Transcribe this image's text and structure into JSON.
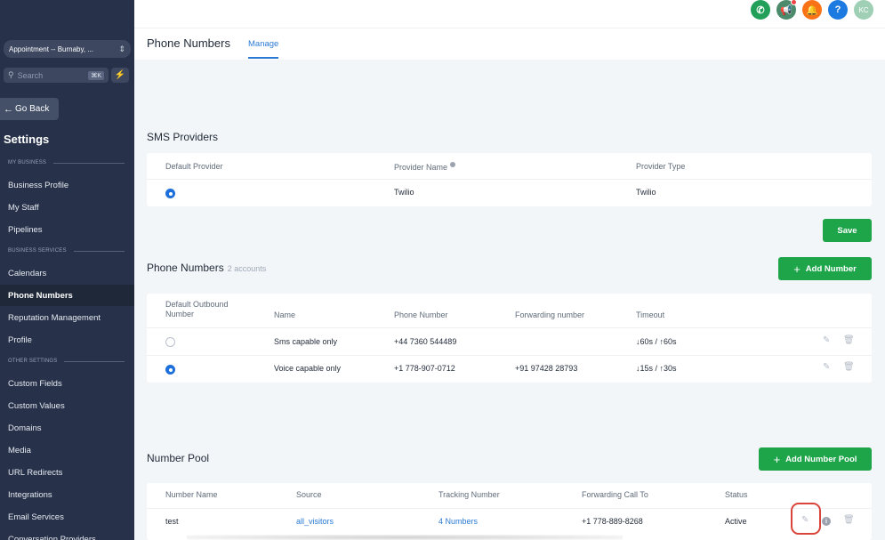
{
  "sidebar": {
    "location": "Appointment -- Burnaby, ...",
    "search_placeholder": "Search",
    "search_shortcut": "⌘K",
    "go_back": "Go Back",
    "title": "Settings",
    "sections": {
      "my_business": "MY BUSINESS",
      "business_services": "BUSINESS SERVICES",
      "other_settings": "OTHER SETTINGS"
    },
    "items": {
      "business_profile": "Business Profile",
      "my_staff": "My Staff",
      "pipelines": "Pipelines",
      "calendars": "Calendars",
      "phone_numbers": "Phone Numbers",
      "reputation": "Reputation Management",
      "profile": "Profile",
      "custom_fields": "Custom Fields",
      "custom_values": "Custom Values",
      "domains": "Domains",
      "media": "Media",
      "url_redirects": "URL Redirects",
      "integrations": "Integrations",
      "email_services": "Email Services",
      "conversation_providers": "Conversation Providers"
    }
  },
  "topbar": {
    "avatar_initials": "KC",
    "help_label": "?"
  },
  "header": {
    "title": "Phone Numbers",
    "tab": "Manage"
  },
  "sms_providers": {
    "title": "SMS Providers",
    "columns": [
      "Default Provider",
      "Provider Name",
      "Provider Type"
    ],
    "row": {
      "name": "Twilio",
      "type": "Twilio"
    },
    "save_label": "Save"
  },
  "phone_numbers": {
    "title": "Phone Numbers",
    "count": "2 accounts",
    "add_label": "Add Number",
    "columns": {
      "default_line1": "Default Outbound",
      "default_line2": "Number",
      "name": "Name",
      "phone": "Phone Number",
      "forwarding": "Forwarding number",
      "timeout": "Timeout"
    },
    "rows": [
      {
        "name": "Sms capable only",
        "phone": "+44 7360 544489",
        "forwarding": "",
        "timeout": "↓60s  / ↑60s"
      },
      {
        "name": "Voice capable only",
        "phone": "+1 778-907-0712",
        "forwarding": "+91 97428 28793",
        "timeout": "↓15s  / ↑30s"
      }
    ]
  },
  "number_pool": {
    "title": "Number Pool",
    "add_label": "Add Number Pool",
    "columns": [
      "Number Name",
      "Source",
      "Tracking Number",
      "Forwarding Call To",
      "Status"
    ],
    "rows": [
      {
        "name": "test",
        "source": "all_visitors",
        "tracking": "4 Numbers",
        "forwarding": "+1 778-889-8268",
        "status": "Active"
      }
    ]
  },
  "colors": {
    "sidebar_bg": "#27324a",
    "accent_blue": "#2a7ad5",
    "primary_green": "#1ea54a",
    "highlight_red": "#d9443b"
  }
}
